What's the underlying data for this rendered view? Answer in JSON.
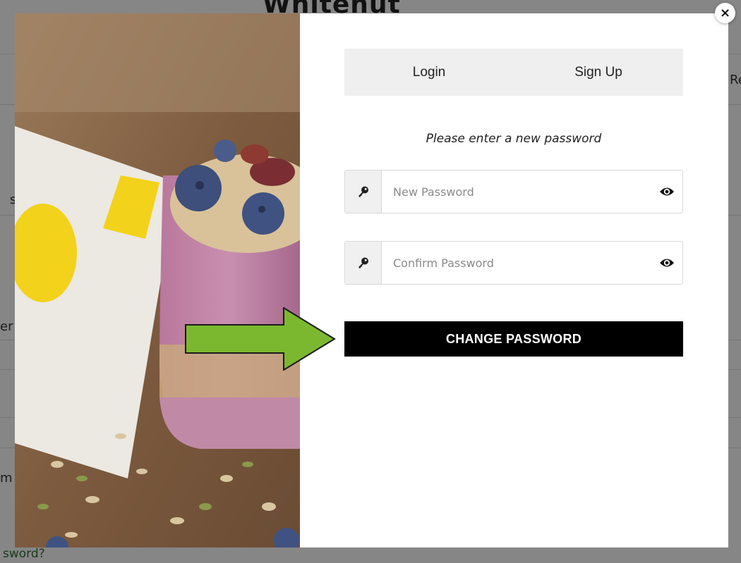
{
  "background": {
    "logo_text": "Whitenut",
    "fragments": [
      "Re",
      "s",
      "er",
      "m"
    ],
    "forgot_link": "sword?"
  },
  "modal": {
    "tabs": [
      {
        "label": "Login"
      },
      {
        "label": "Sign Up"
      }
    ],
    "prompt": "Please enter a new password",
    "new_password": {
      "placeholder": "New Password",
      "value": ""
    },
    "confirm_password": {
      "placeholder": "Confirm Password",
      "value": ""
    },
    "submit_label": "CHANGE PASSWORD",
    "close_label": "×"
  },
  "icons": {
    "field_icon": "key-icon",
    "reveal_icon": "eye-icon",
    "close_icon": "close-icon",
    "annotation": "arrow-right-icon"
  },
  "colors": {
    "button_bg": "#000000",
    "tabs_bg": "#efefef",
    "arrow_fill": "#7cb82f"
  }
}
